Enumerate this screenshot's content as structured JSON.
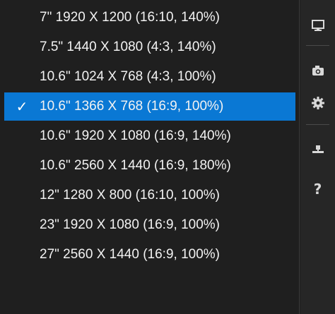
{
  "menu": {
    "items": [
      {
        "label": "7\" 1920 X 1200 (16:10, 140%)",
        "selected": false
      },
      {
        "label": "7.5\" 1440 X 1080 (4:3, 140%)",
        "selected": false
      },
      {
        "label": "10.6\" 1024 X 768 (4:3, 100%)",
        "selected": false
      },
      {
        "label": "10.6\" 1366 X 768 (16:9, 100%)",
        "selected": true
      },
      {
        "label": "10.6\" 1920 X 1080 (16:9, 140%)",
        "selected": false
      },
      {
        "label": "10.6\" 2560 X 1440 (16:9, 180%)",
        "selected": false
      },
      {
        "label": "12\" 1280 X 800 (16:10, 100%)",
        "selected": false
      },
      {
        "label": "23\" 1920 X 1080 (16:9, 100%)",
        "selected": false
      },
      {
        "label": "27\" 2560 X 1440 (16:9, 100%)",
        "selected": false
      }
    ],
    "check_glyph": "✓"
  },
  "toolbar": {
    "buttons": [
      {
        "icon": "monitor-icon"
      },
      {
        "icon": "camera-icon"
      },
      {
        "icon": "gear-icon"
      },
      {
        "icon": "network-icon"
      },
      {
        "icon": "help-icon",
        "glyph": "?"
      }
    ]
  },
  "colors": {
    "menu_background": "#1f1f1f",
    "selected_background": "#0a78d4",
    "text": "#f2f2f2",
    "toolbar_background": "#262626"
  }
}
